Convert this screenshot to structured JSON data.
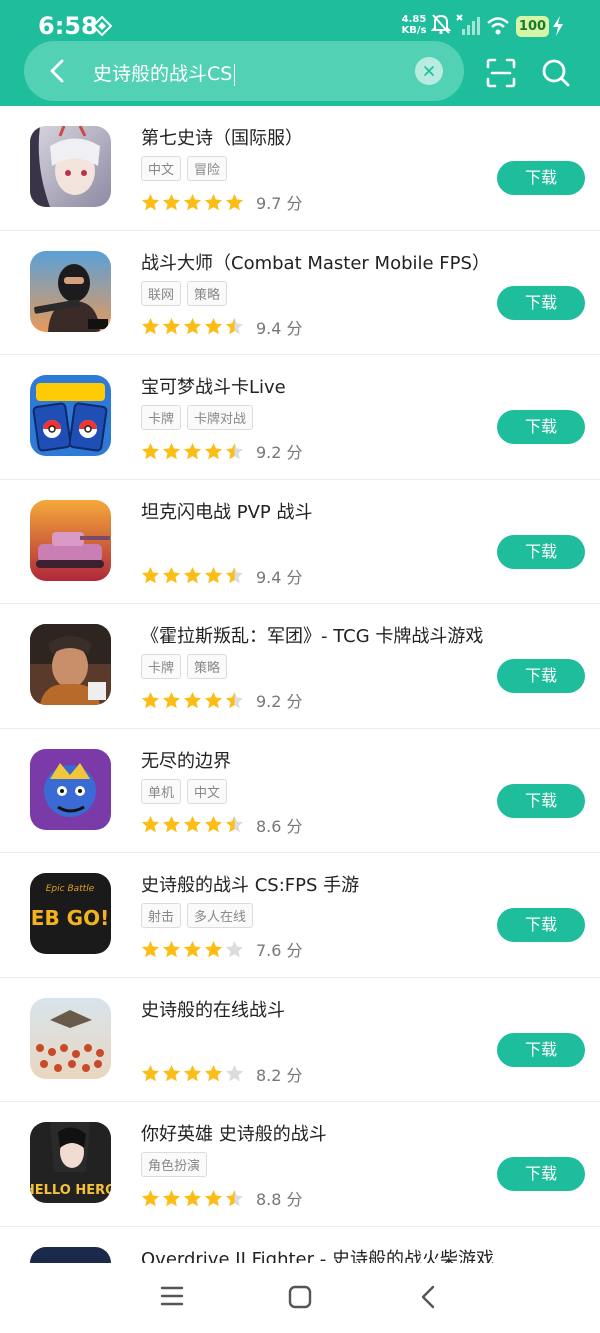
{
  "status": {
    "time": "6:58",
    "net_speed_value": "4.85",
    "net_speed_unit": "KB/s",
    "battery": "100"
  },
  "search": {
    "query": "史诗般的战斗CS"
  },
  "download_label": "下载",
  "score_unit": "分",
  "apps": [
    {
      "name": "第七史诗（国际服）",
      "tags": [
        "中文",
        "冒险"
      ],
      "stars": 5,
      "score": "9.7"
    },
    {
      "name": "战斗大师（Combat Master Mobile FPS）",
      "tags": [
        "联网",
        "策略"
      ],
      "stars": 4.5,
      "score": "9.4"
    },
    {
      "name": "宝可梦战斗卡Live",
      "tags": [
        "卡牌",
        "卡牌对战"
      ],
      "stars": 4.5,
      "score": "9.2"
    },
    {
      "name": "坦克闪电战 PVP 战斗",
      "tags": [],
      "stars": 4.5,
      "score": "9.4"
    },
    {
      "name": "《霍拉斯叛乱：军团》- TCG 卡牌战斗游戏",
      "tags": [
        "卡牌",
        "策略"
      ],
      "stars": 4.5,
      "score": "9.2"
    },
    {
      "name": "无尽的边界",
      "tags": [
        "单机",
        "中文"
      ],
      "stars": 4.5,
      "score": "8.6"
    },
    {
      "name": "史诗般的战斗 CS:FPS 手游",
      "tags": [
        "射击",
        "多人在线"
      ],
      "stars": 4,
      "score": "7.6",
      "icon_text": "EB GO!",
      "icon_top_text": "Epic Battle"
    },
    {
      "name": "史诗般的在线战斗",
      "tags": [],
      "stars": 4,
      "score": "8.2"
    },
    {
      "name": "你好英雄 史诗般的战斗",
      "tags": [
        "角色扮演"
      ],
      "stars": 4.5,
      "score": "8.8",
      "icon_text": "HELLO HERO"
    }
  ],
  "partial_app": {
    "name": "Overdrive II Fighter - 史诗般的战火柴游戏"
  },
  "colors": {
    "accent": "#1ebd9b",
    "star": "#fbbd16",
    "star_empty": "#dcdcdc"
  }
}
